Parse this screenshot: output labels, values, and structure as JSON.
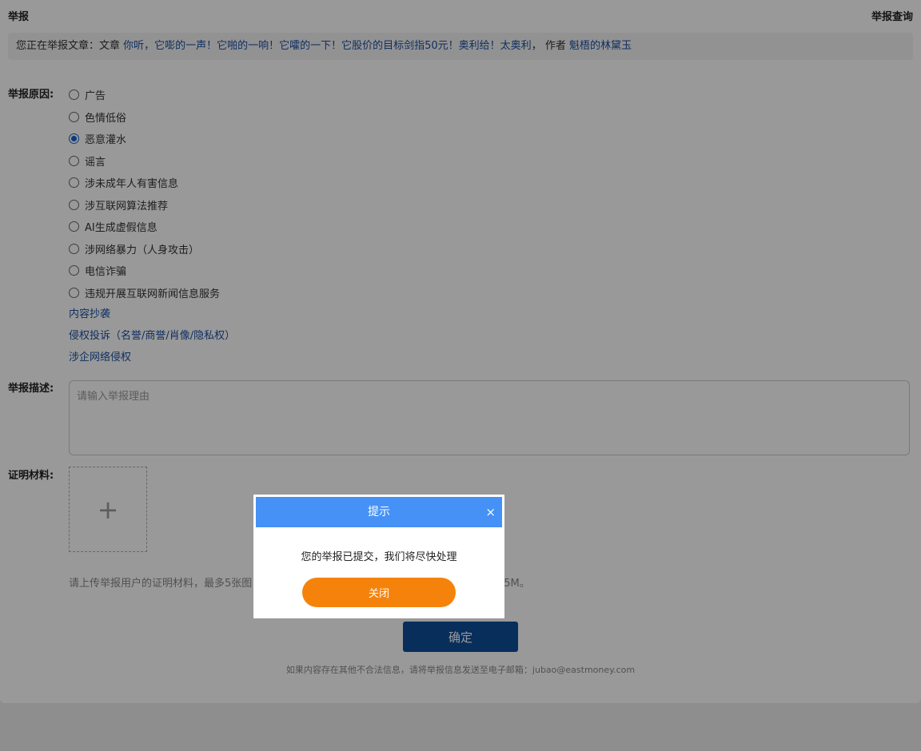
{
  "header": {
    "title": "举报",
    "query_link": "举报查询"
  },
  "notice": {
    "prefix": "您正在举报文章：文章 ",
    "article_title": "你听，它嘭的一声！它啪的一响！它嚯的一下！它股价的目标剑指50元！奥利给！太奥利",
    "separator": "，  作者 ",
    "author": "魁梧的林黛玉"
  },
  "form": {
    "reason_label": "举报原因:",
    "reasons": [
      {
        "label": "广告",
        "checked": false
      },
      {
        "label": "色情低俗",
        "checked": false
      },
      {
        "label": "恶意灌水",
        "checked": true
      },
      {
        "label": "谣言",
        "checked": false
      },
      {
        "label": "涉未成年人有害信息",
        "checked": false
      },
      {
        "label": "涉互联网算法推荐",
        "checked": false
      },
      {
        "label": "AI生成虚假信息",
        "checked": false
      },
      {
        "label": "涉网络暴力（人身攻击）",
        "checked": false
      },
      {
        "label": "电信诈骗",
        "checked": false
      },
      {
        "label": "违规开展互联网新闻信息服务",
        "checked": false
      }
    ],
    "reason_links": [
      "内容抄袭",
      "侵权投诉（名誉/商誉/肖像/隐私权）",
      "涉企网络侵权"
    ],
    "description_label": "举报描述:",
    "description_placeholder": "请输入举报理由",
    "description_value": "",
    "evidence_label": "证明材料:",
    "upload_symbol": "+",
    "upload_hint_left": "请上传举报用户的证明材料，最多5张图",
    "upload_hint_right": "5M。",
    "submit_label": "确定",
    "footer_note": "如果内容存在其他不合法信息，请将举报信息发送至电子邮箱：jubao@eastmoney.com"
  },
  "dialog": {
    "title": "提示",
    "close_symbol": "×",
    "message": "您的举报已提交，我们将尽快处理",
    "button_label": "关闭"
  },
  "colors": {
    "link_blue": "#1b4fa0",
    "submit_blue": "#0e4d9a",
    "dialog_header": "#4591f5",
    "close_orange": "#f5830b",
    "radio_checked": "#1a5fd0"
  }
}
